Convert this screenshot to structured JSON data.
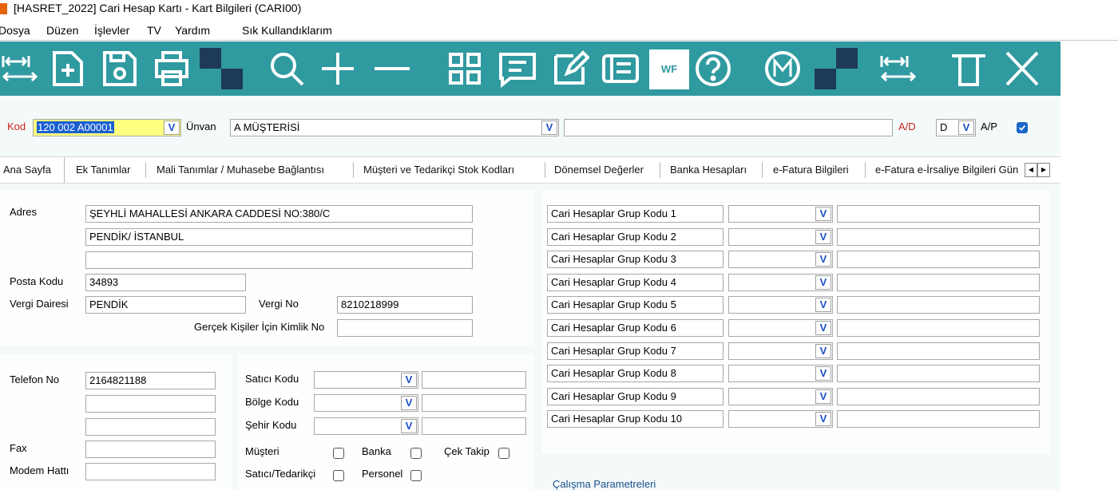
{
  "window": {
    "title": "[HASRET_2022] Cari Hesap Kartı - Kart Bilgileri (CARI00)"
  },
  "menu": [
    "Dosya",
    "Düzen",
    "İşlevler",
    "TV",
    "Yardım",
    "Sık Kullandıklarım"
  ],
  "toolbar": {
    "wf_label": "WF"
  },
  "header": {
    "kod_label": "Kod",
    "kod_value": "120 002 A00001",
    "unvan_label": "Ünvan",
    "unvan_value": "A MÜŞTERİSİ",
    "unvan2_value": "",
    "ad_label": "A/D",
    "ad_value": "D",
    "ap_label": "A/P",
    "ap_checked": true
  },
  "tabs": [
    "Ana Sayfa",
    "Ek Tanımlar",
    "Mali Tanımlar / Muhasebe Bağlantısı",
    "Müşteri ve Tedarikçi Stok Kodları",
    "Dönemsel Değerler",
    "Banka Hesapları",
    "e-Fatura Bilgileri",
    "e-Fatura e-İrsaliye Bilgileri Gün"
  ],
  "address": {
    "label": "Adres",
    "line1": "ŞEYHLİ MAHALLESİ ANKARA CADDESİ NO:380/C",
    "line2": "PENDİK/ İSTANBUL",
    "line3": "",
    "posta_label": "Posta Kodu",
    "posta_value": "34893",
    "vd_label": "Vergi Dairesi",
    "vd_value": "PENDİK",
    "vno_label": "Vergi No",
    "vno_value": "8210218999",
    "tc_label": "Gerçek Kişiler İçin Kimlik No",
    "tc_value": ""
  },
  "contact": {
    "tel_label": "Telefon No",
    "tel_values": [
      "2164821188",
      "",
      ""
    ],
    "fax_label": "Fax",
    "fax_value": "",
    "modem_label": "Modem Hattı",
    "modem_value": ""
  },
  "codes": [
    {
      "label": "Satıcı Kodu",
      "value": "",
      "desc": ""
    },
    {
      "label": "Bölge Kodu",
      "value": "",
      "desc": ""
    },
    {
      "label": "Şehir Kodu",
      "value": "",
      "desc": ""
    }
  ],
  "flags": {
    "musteri": "Müşteri",
    "banka": "Banka",
    "cek": "Çek Takip",
    "satici": "Satıcı/Tedarikçi",
    "personel": "Personel"
  },
  "groups": [
    {
      "label": "Cari Hesaplar Grup Kodu 1",
      "value": "",
      "desc": ""
    },
    {
      "label": "Cari Hesaplar Grup Kodu 2",
      "value": "",
      "desc": ""
    },
    {
      "label": "Cari Hesaplar Grup Kodu 3",
      "value": "",
      "desc": ""
    },
    {
      "label": "Cari Hesaplar Grup Kodu 4",
      "value": "",
      "desc": ""
    },
    {
      "label": "Cari Hesaplar Grup Kodu 5",
      "value": "",
      "desc": ""
    },
    {
      "label": "Cari Hesaplar Grup Kodu 6",
      "value": "",
      "desc": ""
    },
    {
      "label": "Cari Hesaplar Grup Kodu 7",
      "value": "",
      "desc": ""
    },
    {
      "label": "Cari Hesaplar Grup Kodu 8",
      "value": "",
      "desc": ""
    },
    {
      "label": "Cari Hesaplar Grup Kodu 9",
      "value": "",
      "desc": ""
    },
    {
      "label": "Cari Hesaplar Grup Kodu 10",
      "value": "",
      "desc": ""
    }
  ],
  "params_label": "Çalışma Parametreleri",
  "colors": {
    "toolbar": "#2f9aa0",
    "accent": "#1a66c8",
    "kod_highlight": "#ffff80",
    "required_label": "#d02020"
  }
}
